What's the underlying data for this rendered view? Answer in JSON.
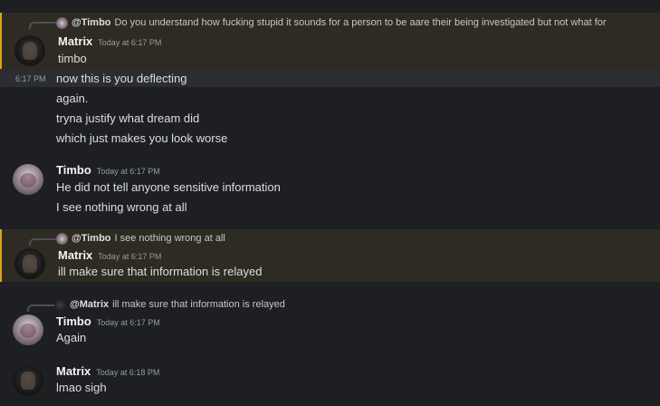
{
  "messages": [
    {
      "reply": {
        "name": "@Timbo",
        "text": "Do you understand how fucking stupid it sounds for a person to be aare their being investigated but not what for"
      },
      "author": "Matrix",
      "timestamp": "Today at 6:17 PM",
      "lines": [
        "timbo"
      ]
    },
    {
      "side_time": "6:17 PM",
      "lines": [
        "now this is you deflecting",
        "again.",
        "tryna justify what dream did",
        "which just makes you look worse"
      ]
    },
    {
      "author": "Timbo",
      "timestamp": "Today at 6:17 PM",
      "lines": [
        "He did not tell anyone sensitive information",
        "I see nothing wrong at all"
      ]
    },
    {
      "reply": {
        "name": "@Timbo",
        "text": "I see nothing wrong at all"
      },
      "author": "Matrix",
      "timestamp": "Today at 6:17 PM",
      "lines": [
        "ill make sure that information is relayed"
      ]
    },
    {
      "reply": {
        "name": "@Matrix",
        "text": "ill make sure that information is relayed"
      },
      "author": "Timbo",
      "timestamp": "Today at 6:17 PM",
      "lines": [
        "Again"
      ]
    },
    {
      "author": "Matrix",
      "timestamp": "Today at 6:18 PM",
      "lines": [
        "lmao sigh"
      ]
    }
  ],
  "colors": {
    "background": "#1e1f22",
    "mention_highlight_bg": "#2e2b22",
    "mention_highlight_border": "#d6a42b",
    "timestamp": "#949ba4",
    "text": "#dbdee1"
  }
}
